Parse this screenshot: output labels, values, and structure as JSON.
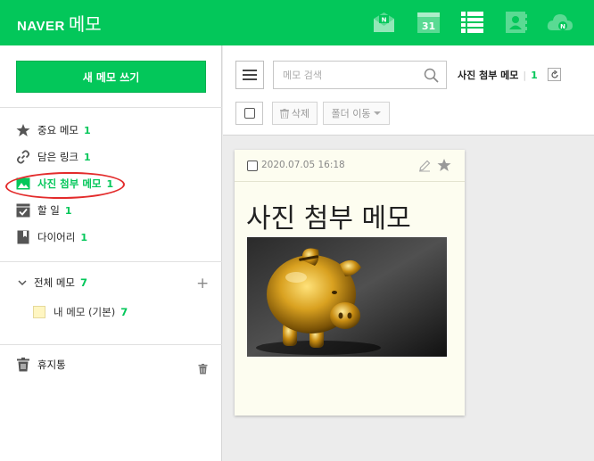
{
  "header": {
    "brand": "NAVER",
    "app_name": "메모",
    "accent": "#03c75a",
    "icons": [
      "mail-icon",
      "calendar-icon",
      "memo-icon",
      "contacts-icon",
      "cloud-icon"
    ],
    "calendar_day": "31",
    "mail_badge": "N",
    "cloud_badge": "N"
  },
  "sidebar": {
    "new_button": "새 메모 쓰기",
    "items": [
      {
        "label": "중요 메모",
        "count": "1",
        "icon": "star-icon"
      },
      {
        "label": "담은 링크",
        "count": "1",
        "icon": "link-icon"
      },
      {
        "label": "사진 첨부 메모",
        "count": "1",
        "icon": "image-icon"
      },
      {
        "label": "할 일",
        "count": "1",
        "icon": "checkbox-icon"
      },
      {
        "label": "다이어리",
        "count": "1",
        "icon": "bookmark-icon"
      }
    ],
    "all_memos": {
      "label": "전체 메모",
      "count": "7"
    },
    "folder": {
      "label": "내 메모 (기본)",
      "count": "7"
    },
    "trash": "휴지통"
  },
  "toolbar": {
    "search_placeholder": "메모 검색",
    "current_folder": "사진 첨부 메모",
    "current_count": "1",
    "delete_label": "삭제",
    "move_label": "폴더 이동"
  },
  "memo": {
    "date": "2020.07.05 16:18",
    "title": "사진 첨부 메모",
    "image_alt": "golden-piggy-bank"
  }
}
